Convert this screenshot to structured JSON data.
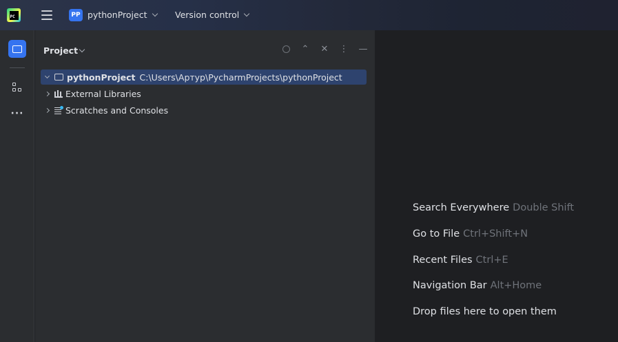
{
  "titlebar": {
    "app_icon_text": "PC",
    "project_badge": "PP",
    "project_name": "pythonProject",
    "vcs_label": "Version control"
  },
  "project_panel": {
    "title": "Project",
    "tree": [
      {
        "name": "pythonProject",
        "path": "C:\\Users\\Артур\\PycharmProjects\\pythonProject",
        "expanded": true,
        "selected": true
      },
      {
        "name": "External Libraries",
        "expanded": false
      },
      {
        "name": "Scratches and Consoles",
        "expanded": false
      }
    ]
  },
  "editor_hints": [
    {
      "label": "Search Everywhere",
      "shortcut": "Double Shift"
    },
    {
      "label": "Go to File",
      "shortcut": "Ctrl+Shift+N"
    },
    {
      "label": "Recent Files",
      "shortcut": "Ctrl+E"
    },
    {
      "label": "Navigation Bar",
      "shortcut": "Alt+Home"
    },
    {
      "label": "Drop files here to open them",
      "shortcut": ""
    }
  ],
  "colors": {
    "accent": "#3574f0",
    "selection": "#2e436e",
    "panel_bg": "#2b2d30",
    "editor_bg": "#1e1f22"
  }
}
